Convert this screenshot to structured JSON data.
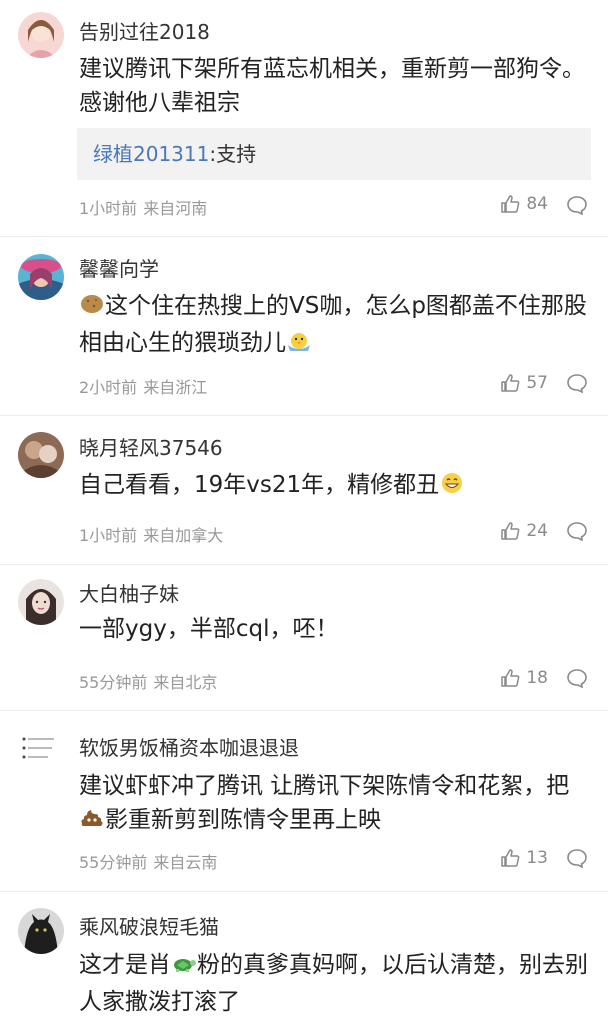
{
  "comments": [
    {
      "username": "告别过往2018",
      "text": "建议腾讯下架所有蓝忘机相关，重新剪一部狗令。感谢他八辈祖宗",
      "reply": {
        "user": "绿植201311",
        "sep": ":",
        "text": "支持"
      },
      "time": "1小时前",
      "location": "来自河南",
      "likes": "84"
    },
    {
      "username": "馨馨向学",
      "text_before": "这个住在热搜上的VS咖，怎么p图都盖不住那股相由心生的猥琐劲儿",
      "lead_emoji": "potato-emoji",
      "trail_emoji": "chick-emoji",
      "time": "2小时前",
      "location": "来自浙江",
      "likes": "57"
    },
    {
      "username": "晓月轻风37546",
      "text": "自己看看，19年vs21年，精修都丑",
      "trail_emoji": "grin-emoji",
      "time": "1小时前",
      "location": "来自加拿大",
      "likes": "24"
    },
    {
      "username": "大白柚子妹",
      "text": "一部ygy，半部cql，呸！",
      "time": "55分钟前",
      "location": "来自北京",
      "likes": "18"
    },
    {
      "username": "软饭男饭桶资本咖退退退",
      "text_a": "建议虾虾冲了腾讯 让腾讯下架陈情令和花絮，把",
      "text_b": "影重新剪到陈情令里再上映",
      "inline_emoji": "poop-emoji",
      "time": "55分钟前",
      "location": "来自云南",
      "likes": "13"
    },
    {
      "username": "乘风破浪短毛猫",
      "text_a": "这才是肖",
      "text_b": "粉的真爹真妈啊，以后认清楚，别去别人家撒泼打滚了",
      "inline_emoji": "turtle-emoji"
    }
  ],
  "colors": {
    "reply_user": "#4a78b8",
    "meta": "#999999"
  }
}
